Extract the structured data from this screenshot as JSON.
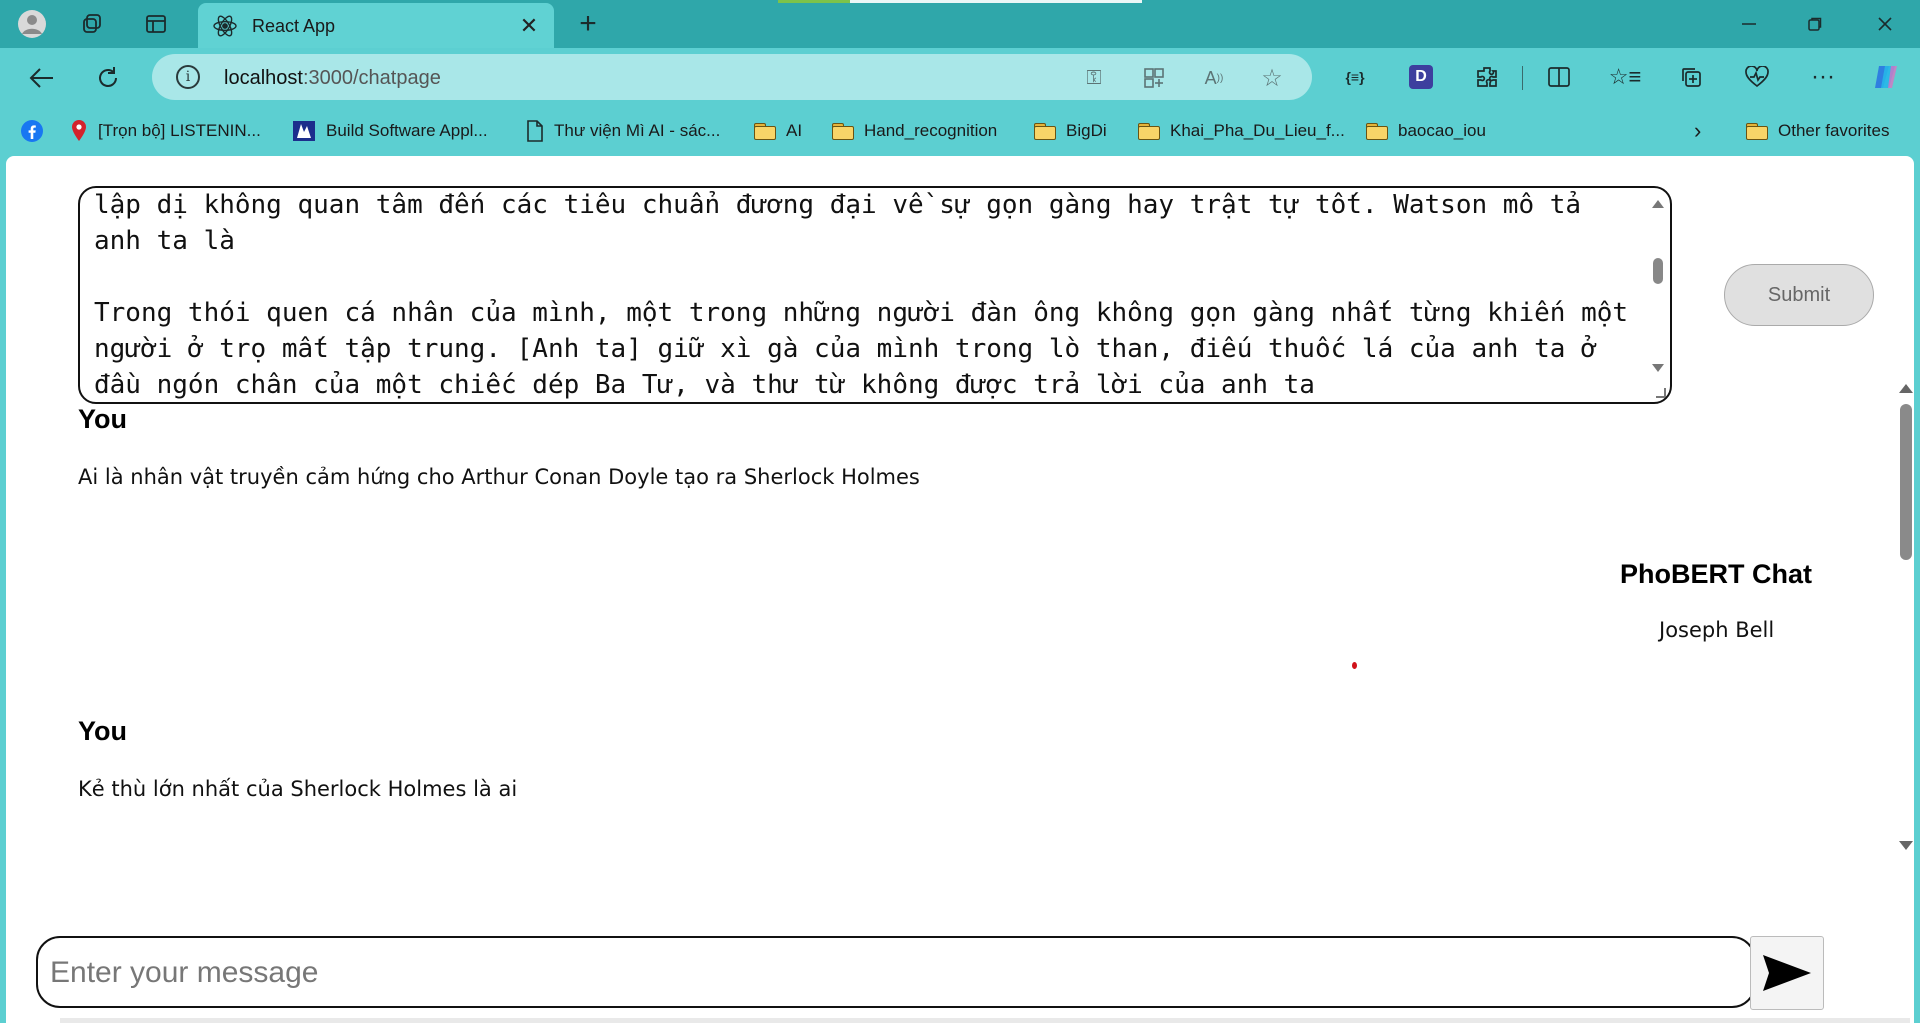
{
  "browser": {
    "tab": {
      "title": "React App",
      "favicon": "react-icon"
    },
    "address": {
      "host": "localhost",
      "path": ":3000/chatpage"
    },
    "accent": "#2fa7aa"
  },
  "favorites": [
    {
      "label": "",
      "icon": "facebook-icon"
    },
    {
      "label": "[Trọn bộ] LISTENIN...",
      "icon": "map-pin-icon"
    },
    {
      "label": "Build Software Appl...",
      "icon": "site-icon"
    },
    {
      "label": "Thư viện Mì AI - sác...",
      "icon": "page-icon"
    },
    {
      "label": "AI",
      "icon": "folder-icon"
    },
    {
      "label": "Hand_recognition",
      "icon": "folder-icon"
    },
    {
      "label": "BigDi",
      "icon": "folder-icon"
    },
    {
      "label": "Khai_Pha_Du_Lieu_f...",
      "icon": "folder-icon"
    },
    {
      "label": "baocao_iou",
      "icon": "folder-icon"
    },
    {
      "label": "Other favorites",
      "icon": "folder-icon"
    }
  ],
  "context": {
    "text": "lập dị không quan tâm đến các tiêu chuẩn đương đại về sự gọn gàng hay trật tự tốt. Watson mô tả anh ta là\n\nTrong thói quen cá nhân của mình, một trong những người đàn ông không gọn gàng nhất từng khiến một người ở trọ mất tập trung. [Anh ta] giữ xì gà của mình trong lò than, điếu thuốc lá của anh ta ở đầu ngón chân của một chiếc dép Ba Tư, và thư từ không được trả lời của anh ta"
  },
  "submit_label": "Submit",
  "chat": {
    "you_label": "You",
    "bot_label": "PhoBERT Chat",
    "messages": [
      {
        "sender": "You",
        "text": "Ai là nhân vật truyền cảm hứng cho Arthur Conan Doyle tạo ra Sherlock Holmes"
      },
      {
        "sender": "PhoBERT Chat",
        "text": "Joseph Bell"
      },
      {
        "sender": "You",
        "text": "Kẻ thù lớn nhất của Sherlock Holmes là ai"
      }
    ]
  },
  "input": {
    "placeholder": "Enter your message",
    "value": ""
  }
}
